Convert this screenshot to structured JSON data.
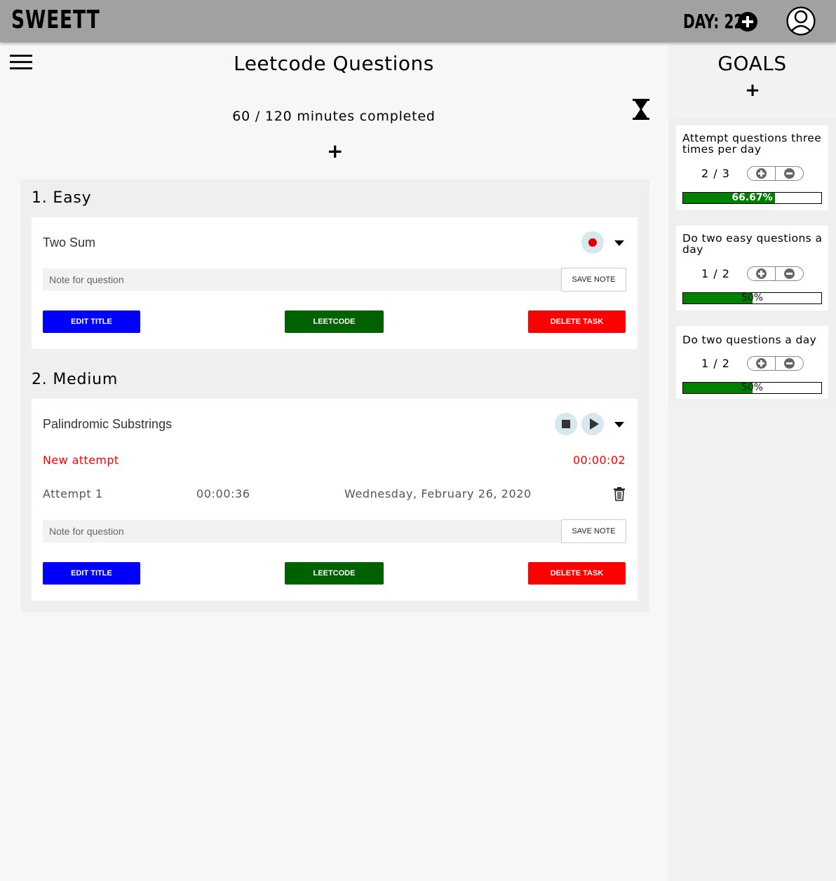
{
  "header": {
    "brand": "SWEETT",
    "day_label": "DAY: 22"
  },
  "main": {
    "title": "Leetcode Questions",
    "minutes_completed": "60 / 120 minutes completed",
    "add_symbol": "+",
    "sections": [
      {
        "title": "1. Easy",
        "task": {
          "name": "Two Sum",
          "note_placeholder": "Note for question",
          "save_note": "SAVE NOTE",
          "edit_title": "EDIT TITLE",
          "leetcode": "LEETCODE",
          "delete_task": "DELETE TASK"
        }
      },
      {
        "title": "2. Medium",
        "task": {
          "name": "Palindromic Substrings",
          "new_attempt": "New attempt",
          "timer": "00:00:02",
          "attempts": [
            {
              "label": "Attempt 1",
              "duration": "00:00:36",
              "date": "Wednesday, February 26, 2020"
            }
          ],
          "note_placeholder": "Note for question",
          "save_note": "SAVE NOTE",
          "edit_title": "EDIT TITLE",
          "leetcode": "LEETCODE",
          "delete_task": "DELETE TASK"
        }
      }
    ]
  },
  "goals": {
    "title": "GOALS",
    "add_symbol": "+",
    "items": [
      {
        "text": "Attempt questions three times per day",
        "count": "2 / 3",
        "progress": 0.6667,
        "progress_label": "66.67%"
      },
      {
        "text": "Do two easy questions a day",
        "count": "1 / 2",
        "progress": 0.5,
        "progress_label": "50%"
      },
      {
        "text": "Do two questions a day",
        "count": "1 / 2",
        "progress": 0.5,
        "progress_label": "50%"
      }
    ]
  },
  "colors": {
    "header_bg": "#a1a1a1",
    "edit_button": "#0000ff",
    "leetcode_button": "#006100",
    "delete_button": "#ff0000",
    "progress_fill": "#008000",
    "attempt_text": "#ff0000",
    "record_dot": "#e00000"
  },
  "icons": [
    "menu-icon",
    "plus-circle-icon",
    "user-avatar-icon",
    "hourglass-icon",
    "record-icon",
    "stop-icon",
    "play-icon",
    "chevron-down-icon",
    "trash-icon",
    "plus-icon",
    "minus-icon"
  ]
}
